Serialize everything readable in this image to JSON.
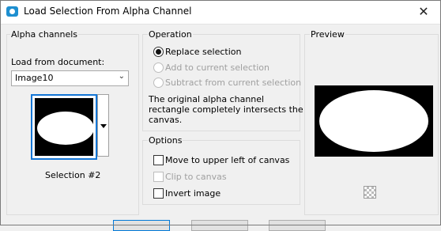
{
  "window": {
    "title": "Load Selection From Alpha Channel",
    "close_glyph": "✕",
    "app_icon": "camera-icon"
  },
  "alpha_channels": {
    "label": "Alpha channels",
    "load_from_label": "Load from document:",
    "document_value": "Image10",
    "selection_name": "Selection #2"
  },
  "operation": {
    "label": "Operation",
    "options": [
      {
        "label": "Replace selection",
        "checked": true,
        "enabled": true
      },
      {
        "label": "Add to current selection",
        "checked": false,
        "enabled": false
      },
      {
        "label": "Subtract from current selection",
        "checked": false,
        "enabled": false
      }
    ],
    "message_lines": [
      "The original alpha channel",
      "rectangle completely intersects the",
      "canvas."
    ]
  },
  "options": {
    "label": "Options",
    "items": [
      {
        "label": "Move to upper left of canvas",
        "checked": false,
        "enabled": true
      },
      {
        "label": "Clip to canvas",
        "checked": false,
        "enabled": false
      },
      {
        "label": "Invert image",
        "checked": false,
        "enabled": true
      }
    ]
  },
  "preview": {
    "label": "Preview",
    "toggle_icon": "checkerboard-icon"
  },
  "colors": {
    "accent": "#1476d6",
    "disabled_text": "#a0a0a0"
  }
}
